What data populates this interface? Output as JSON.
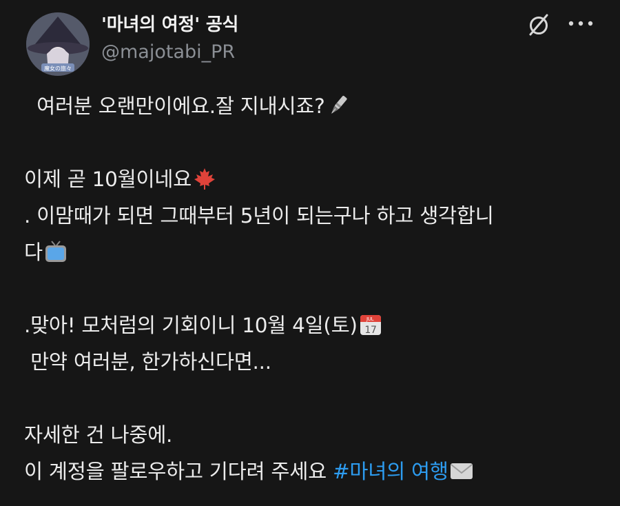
{
  "author": {
    "display_name": "'마녀의 여정' 공식",
    "handle": "@majotabi_PR"
  },
  "icons": {
    "grok": "slashed-circle-icon",
    "more": "more-dots-icon"
  },
  "post": {
    "line1": "여러분 오랜만이에요.잘 지내시죠?",
    "line2": "이제 곧 10월이네요",
    "line3": ". 이맘때가 되면 그때부터 5년이 되는구나 하고 생각합니",
    "line4": "다",
    "line5": ".맞아! 모처럼의 기회이니 10월 4일(토)",
    "line6": "만약 여러분, 한가하신다면...",
    "line7": "자세한 건 나중에.",
    "line8": "이 계정을 팔로우하고 기다려 주세요 ",
    "hashtag": "#마녀의 여행"
  },
  "emoji": {
    "calendar_month": "JUL",
    "calendar_day": "17"
  },
  "colors": {
    "background": "#161616",
    "text": "#ececec",
    "secondary": "#8b8f95",
    "link": "#2d9cf0"
  }
}
